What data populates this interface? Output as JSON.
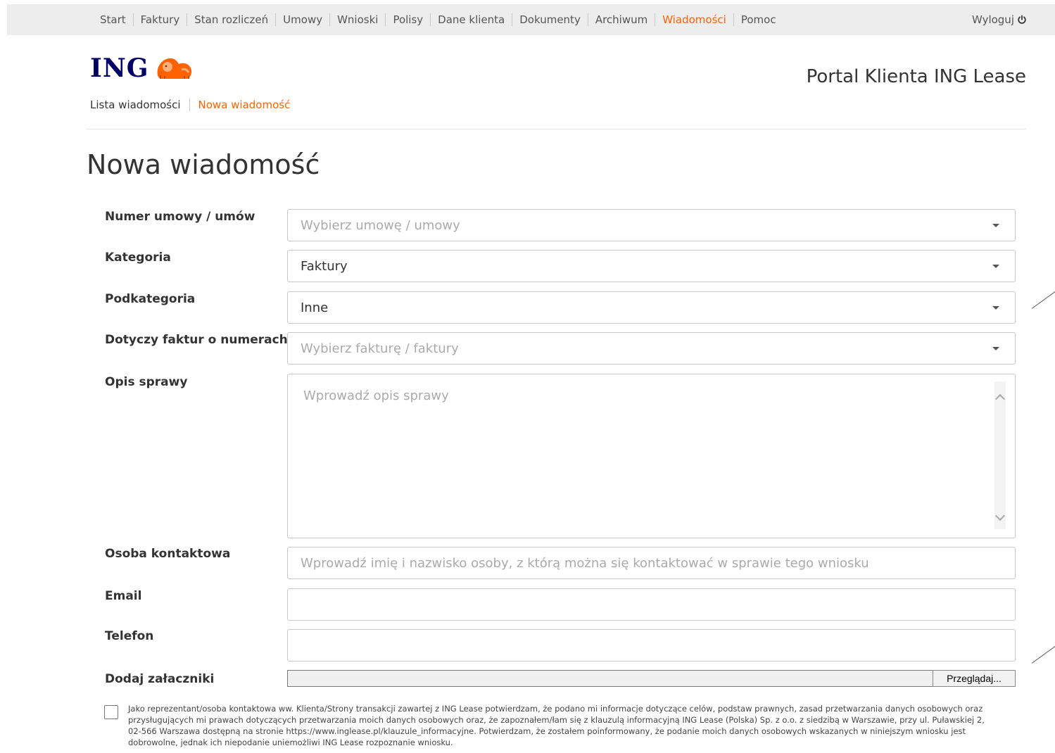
{
  "topnav": {
    "items": [
      {
        "label": "Start"
      },
      {
        "label": "Faktury"
      },
      {
        "label": "Stan rozliczeń"
      },
      {
        "label": "Umowy"
      },
      {
        "label": "Wnioski"
      },
      {
        "label": "Polisy"
      },
      {
        "label": "Dane klienta"
      },
      {
        "label": "Dokumenty"
      },
      {
        "label": "Archiwum"
      },
      {
        "label": "Wiadomości",
        "active": true
      },
      {
        "label": "Pomoc"
      }
    ],
    "logout_label": "Wyloguj"
  },
  "header": {
    "logo_text": "ING",
    "portal_title": "Portal Klienta ING Lease"
  },
  "subnav": {
    "items": [
      {
        "label": "Lista wiadomości"
      },
      {
        "label": "Nowa wiadomość",
        "active": true
      }
    ]
  },
  "page": {
    "title": "Nowa wiadomość"
  },
  "form": {
    "contract": {
      "label": "Numer umowy / umów",
      "placeholder": "Wybierz umowę / umowy"
    },
    "category": {
      "label": "Kategoria",
      "value": "Faktury"
    },
    "subcategory": {
      "label": "Podkategoria",
      "value": "Inne"
    },
    "invoices": {
      "label": "Dotyczy faktur o numerach",
      "placeholder": "Wybierz fakturę / faktury"
    },
    "description": {
      "label": "Opis sprawy",
      "placeholder": "Wprowadź opis sprawy"
    },
    "contact": {
      "label": "Osoba kontaktowa",
      "placeholder": "Wprowadź imię i nazwisko osoby, z którą można się kontaktować w sprawie tego wniosku"
    },
    "email": {
      "label": "Email",
      "value": ""
    },
    "phone": {
      "label": "Telefon",
      "value": ""
    },
    "attachments": {
      "label": "Dodaj załaczniki",
      "button_label": "Przeglądaj..."
    }
  },
  "consent": {
    "checked": false,
    "text": "Jako reprezentant/osoba kontaktowa ww. Klienta/Strony transakcji zawartej z ING Lease potwierdzam, że podano mi informacje dotyczące celów, podstaw prawnych, zasad przetwarzania danych osobowych oraz przysługujących mi prawach dotyczących przetwarzania moich danych osobowych oraz, że zapoznałem/łam się z klauzulą informacyjną ING Lease (Polska) Sp. z o.o. z siedzibą w Warszawie, przy ul. Puławskiej 2, 02-566 Warszawa dostępną na stronie https://www.inglease.pl/klauzule_informacyjne. Potwierdzam, że zostałem poinformowany, że podanie moich danych osobowych wskazanych w niniejszym wniosku jest dobrowolne, jednak ich niepodanie uniemożliwi ING Lease rozpoznanie wniosku."
  },
  "colors": {
    "accent": "#ff6200",
    "brand_navy": "#000066"
  }
}
